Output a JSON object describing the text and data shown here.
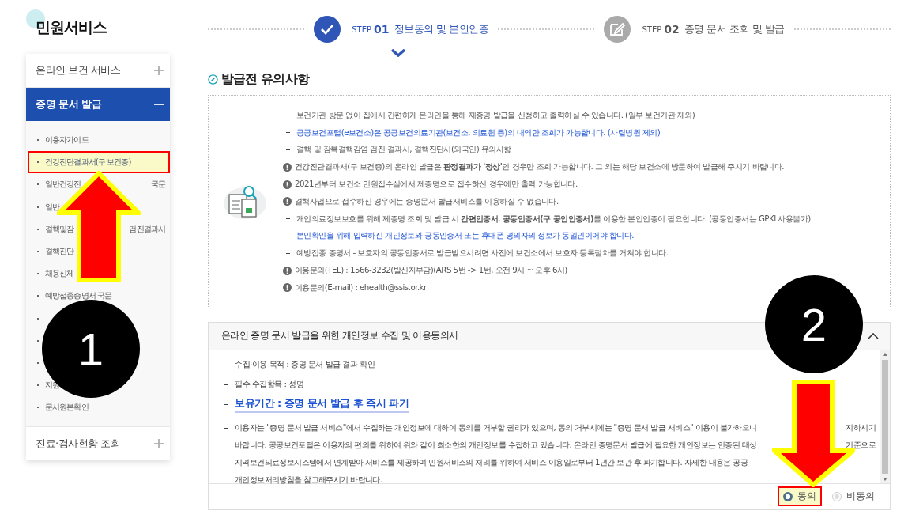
{
  "sidebar": {
    "title": "민원서비스",
    "sections": [
      {
        "label": "온라인 보건 서비스",
        "expanded": false
      },
      {
        "label": "증명 문서 발급",
        "expanded": true,
        "items": [
          {
            "kind": "text",
            "text": "이용자가이드",
            "selected": false
          },
          {
            "kind": "text",
            "text": "건강진단결과서(구 보건증)",
            "selected": true
          },
          {
            "kind": "text",
            "text": "일반건강진",
            "tail": "국문",
            "selected": false
          },
          {
            "kind": "text",
            "text": "일반",
            "selected": false
          },
          {
            "kind": "text",
            "text": "결핵및잠",
            "tail": "검진결과서",
            "selected": false
          },
          {
            "kind": "text",
            "text": "결핵진단",
            "selected": false
          },
          {
            "kind": "text",
            "text": "채용신체",
            "selected": false
          },
          {
            "kind": "text",
            "text": "예방접종증명서 국문",
            "selected": false
          },
          {
            "kind": "covered"
          },
          {
            "kind": "covered"
          },
          {
            "kind": "covered"
          },
          {
            "kind": "text",
            "text": "지원",
            "selected": false
          },
          {
            "kind": "text",
            "text": "문서원본확인",
            "selected": false
          }
        ]
      },
      {
        "label": "진료·검사현황 조회",
        "expanded": false
      }
    ]
  },
  "steps": [
    {
      "step": "STEP",
      "number": "01",
      "label": "정보동의 및 본인인증",
      "selected": true
    },
    {
      "step": "STEP",
      "number": "02",
      "label": "증명 문서 조회 및 발급",
      "selected": false
    }
  ],
  "notice": {
    "title": "발급전 유의사항",
    "lines": [
      {
        "kind": "dash",
        "emphasis": false,
        "text": "보건기관 방문 없이 집에서 간편하게 온라인을 통해 제증명 발급을 신청하고 출력하실 수 있습니다. (일부 보건기관 제외)"
      },
      {
        "kind": "dash",
        "emphasis": true,
        "text": "공공보건포털(e보건소)은 공공보건의료기관(보건소, 의료원 등)의 내역만 조회가 가능합니다. (사립병원 제외)"
      },
      {
        "kind": "dash",
        "emphasis": false,
        "text": "결핵 및 잠복결핵감염 검진 결과서, 결핵진단서(외국인) 유의사항"
      },
      {
        "kind": "alert",
        "emphasis": false,
        "text": "건강진단결과서(구 보건증)의 온라인 발급은 **판정결과가 '정상'**인 경우만 조회 가능합니다. 그 외는 해당 보건소에 방문하여 발급해 주시기 바랍니다."
      },
      {
        "kind": "alert",
        "emphasis": false,
        "text": "2021년부터 보건소 민원접수실에서 제증명으로 접수하신 경우에만 출력 가능합니다."
      },
      {
        "kind": "alert",
        "emphasis": false,
        "text": "결핵사업으로 접수하신 경우에는 증명문서 발급서비스를 이용하실 수 없습니다."
      },
      {
        "kind": "dash",
        "emphasis": false,
        "text": "개인의료정보보호를 위해 제증명 조회 및 발급 시 **간편인증서**, **공동인증서(구 공인인증서)**를 이용한 본인인증이 필요합니다. (공동인증서는 GPKI 사용불가)"
      },
      {
        "kind": "dash",
        "emphasis": true,
        "text": "본인확인을 위해 입력하신 개인정보와 공동인증서 또는 휴대폰 명의자의 정보가 동일인이어야 합니다."
      },
      {
        "kind": "dash",
        "emphasis": false,
        "text": "예방접종 증명서 - 보호자의 공동인증서로 발급받으시려면 사전에 보건소에서 보호자 등록절차를 거쳐야 합니다."
      },
      {
        "kind": "alert",
        "emphasis": false,
        "text": "이용문의(TEL) : 1566-3232(발신자부담)(ARS 5번 -> 1번, 오전 9시 ~ 오후 6시)"
      },
      {
        "kind": "alert",
        "emphasis": false,
        "text": "이용문의(E-mail) : ehealth@ssis.or.kr"
      }
    ]
  },
  "agreement": {
    "title": "온라인 증명 문서 발급을 위한 개인정보 수집 및 이용동의서",
    "expanded": true,
    "items": [
      {
        "kind": "plain",
        "text": "수집·이용 목적 : 증명 문서 발급 결과 확인"
      },
      {
        "kind": "plain",
        "text": "필수 수집항목 : 성명"
      },
      {
        "kind": "highlight",
        "text": "보유기간 : 증명 문서 발급 후 즉시 파기"
      }
    ],
    "paragraph": [
      {
        "text": "이용자는 \"증명 문서 발급 서비스\"에서 수집하는 개인정보에 대하여 동의를 거부할 권리가 있으며, 동의 거부시에는 \"증명 문서 발급 서비스\" 이용이 불가하오니",
        "tail": "지하시기"
      },
      {
        "text": "바랍니다. 공공보건포털은 이용자의 편의를 위하여 위와 같이 최소한의 개인정보를 수집하고 있습니다. 온라인 증명문서 발급에 필요한 개인정보는 인증된 대상",
        "tail": "기준으로"
      },
      {
        "text": "지역보건의료정보시스템에서 연계받아 서비스를 제공하며 민원서비스의 처리를 위하여 서비스 이용일로부터 1년간 보관 후 파기합니다. 자세한 내용은 공공"
      },
      {
        "text": "개인정보처리방침을 참고해주시기 바랍니다."
      }
    ],
    "options": [
      {
        "label": "동의",
        "selected": true,
        "highlighted": true
      },
      {
        "label": "비동의",
        "selected": false,
        "highlighted": false
      }
    ]
  },
  "annotations": [
    {
      "kind": "arrow-up"
    },
    {
      "kind": "number",
      "label": "1"
    },
    {
      "kind": "number",
      "label": "2"
    },
    {
      "kind": "arrow-down"
    }
  ]
}
